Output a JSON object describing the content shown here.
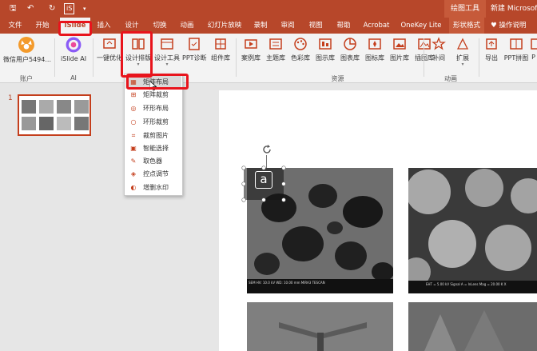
{
  "titlebar": {
    "quick_access": {
      "save": "🖫",
      "undo": "↶",
      "redo": "↻",
      "islide_logo": "iS"
    },
    "contextual_label": "绘图工具",
    "app_title": "新建 Microsoft"
  },
  "tabs": [
    {
      "label": "文件"
    },
    {
      "label": "开始"
    },
    {
      "label": "iSlide"
    },
    {
      "label": "插入"
    },
    {
      "label": "设计"
    },
    {
      "label": "切换"
    },
    {
      "label": "动画"
    },
    {
      "label": "幻灯片放映"
    },
    {
      "label": "录制"
    },
    {
      "label": "审阅"
    },
    {
      "label": "视图"
    },
    {
      "label": "帮助"
    },
    {
      "label": "Acrobat"
    },
    {
      "label": "OneKey Lite"
    },
    {
      "label": "形状格式"
    },
    {
      "label": "操作说明"
    }
  ],
  "ribbon": {
    "account": {
      "user_label": "微信用户5494...",
      "group_label": "账户"
    },
    "ai": {
      "label": "iSlide AI",
      "group_label": "AI"
    },
    "design_buttons": [
      {
        "label": "一键优化"
      },
      {
        "label": "设计排版"
      },
      {
        "label": "设计工具"
      },
      {
        "label": "PPT诊断"
      },
      {
        "label": "组件库"
      }
    ],
    "resource_buttons": [
      {
        "label": "案例库"
      },
      {
        "label": "主题库"
      },
      {
        "label": "色彩库"
      },
      {
        "label": "图示库"
      },
      {
        "label": "图表库"
      },
      {
        "label": "图标库"
      },
      {
        "label": "图片库"
      },
      {
        "label": "插图库"
      }
    ],
    "resource_group_label": "资源",
    "animation_buttons": [
      {
        "label": "补间"
      },
      {
        "label": "扩展"
      }
    ],
    "animation_group_label": "动画",
    "export_buttons": [
      {
        "label": "导出"
      },
      {
        "label": "PPT拼图"
      },
      {
        "label": "P"
      }
    ]
  },
  "dropdown": {
    "items": [
      {
        "label": "矩阵布局",
        "icon": "grid-icon"
      },
      {
        "label": "矩阵裁剪",
        "icon": "crop-grid-icon"
      },
      {
        "label": "环形布局",
        "icon": "ring-icon"
      },
      {
        "label": "环形裁剪",
        "icon": "ring-crop-icon"
      },
      {
        "label": "裁剪图片",
        "icon": "crop-icon"
      },
      {
        "label": "智能选择",
        "icon": "select-icon"
      },
      {
        "label": "取色器",
        "icon": "eyedropper-icon"
      },
      {
        "label": "控点调节",
        "icon": "handle-icon"
      },
      {
        "label": "增删水印",
        "icon": "watermark-icon"
      }
    ]
  },
  "slides_panel": {
    "slide_number": "1"
  },
  "slide": {
    "label_box_text": "a",
    "sem1_footer": "SEM HV: 10.0 kV   WD: 10.00 mm   MIRA3 TESCAN",
    "sem2_footer": "EHT = 5.00 kV   Signal A = InLens   Mag = 20.00 K X"
  },
  "colors": {
    "accent": "#b7472a",
    "highlight_box": "#e8141c",
    "ribbon_bg": "#f3f3f3"
  }
}
